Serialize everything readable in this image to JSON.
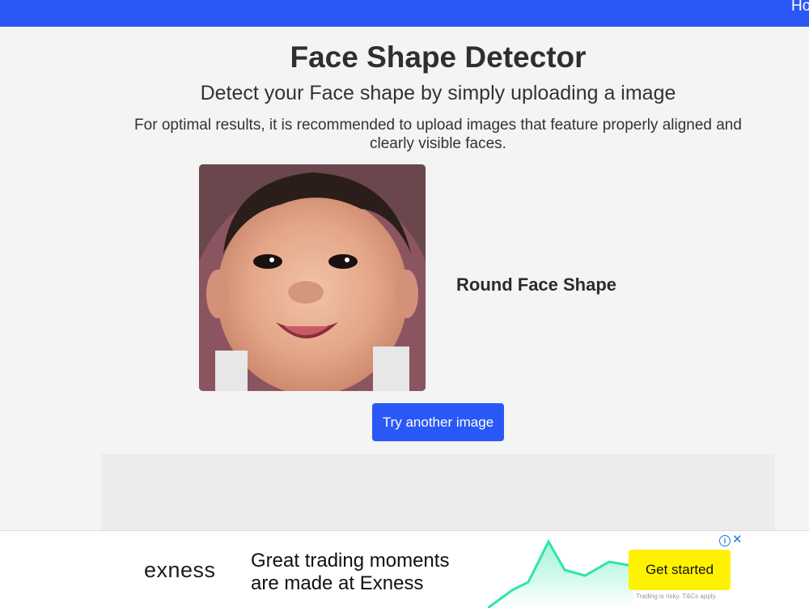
{
  "nav": {
    "partial_item": "Ho"
  },
  "header": {
    "title": "Face Shape Detector",
    "subtitle": "Detect your Face shape by simply uploading a image",
    "note": "For optimal results, it is recommended to upload images that feature properly aligned and clearly visible faces."
  },
  "result": {
    "label": "Round Face Shape",
    "retry_label": "Try another image"
  },
  "ad": {
    "logo": "exness",
    "headline_line1": "Great trading moments",
    "headline_line2": "are made at Exness",
    "cta_label": "Get started",
    "disclaimer": "Trading is risky. T&Cs apply.",
    "info_icon": "info-icon",
    "close_icon": "close-icon"
  },
  "colors": {
    "brand_blue": "#2a58f6",
    "cta_yellow": "#fff200",
    "background": "#f4f4f4"
  }
}
